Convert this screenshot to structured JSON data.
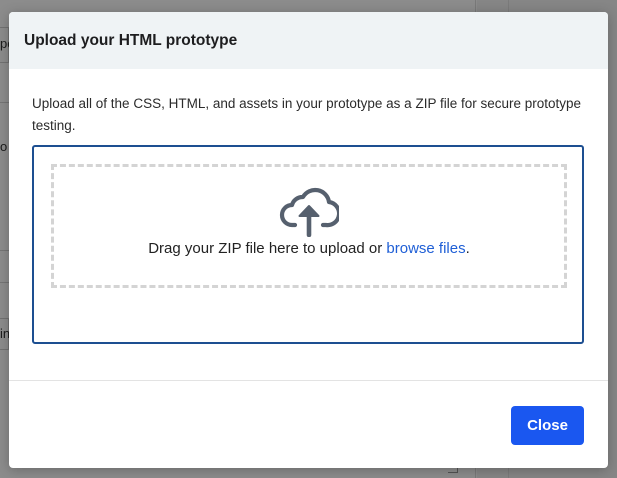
{
  "background": {
    "fragments": [
      "pe",
      "o",
      "in"
    ]
  },
  "modal": {
    "title": "Upload your HTML prototype",
    "description": "Upload all of the CSS, HTML, and assets in your prototype as a ZIP file for secure prototype testing.",
    "dropzone": {
      "icon": "cloud-upload-icon",
      "text_before": "Drag your ZIP file here to upload or ",
      "link_text": "browse files",
      "text_after": "."
    },
    "footer": {
      "close_label": "Close"
    }
  },
  "colors": {
    "accent": "#1a57f0",
    "link": "#1f5fd6",
    "panel_border": "#1d4f91",
    "header_bg": "#eff3f5"
  }
}
